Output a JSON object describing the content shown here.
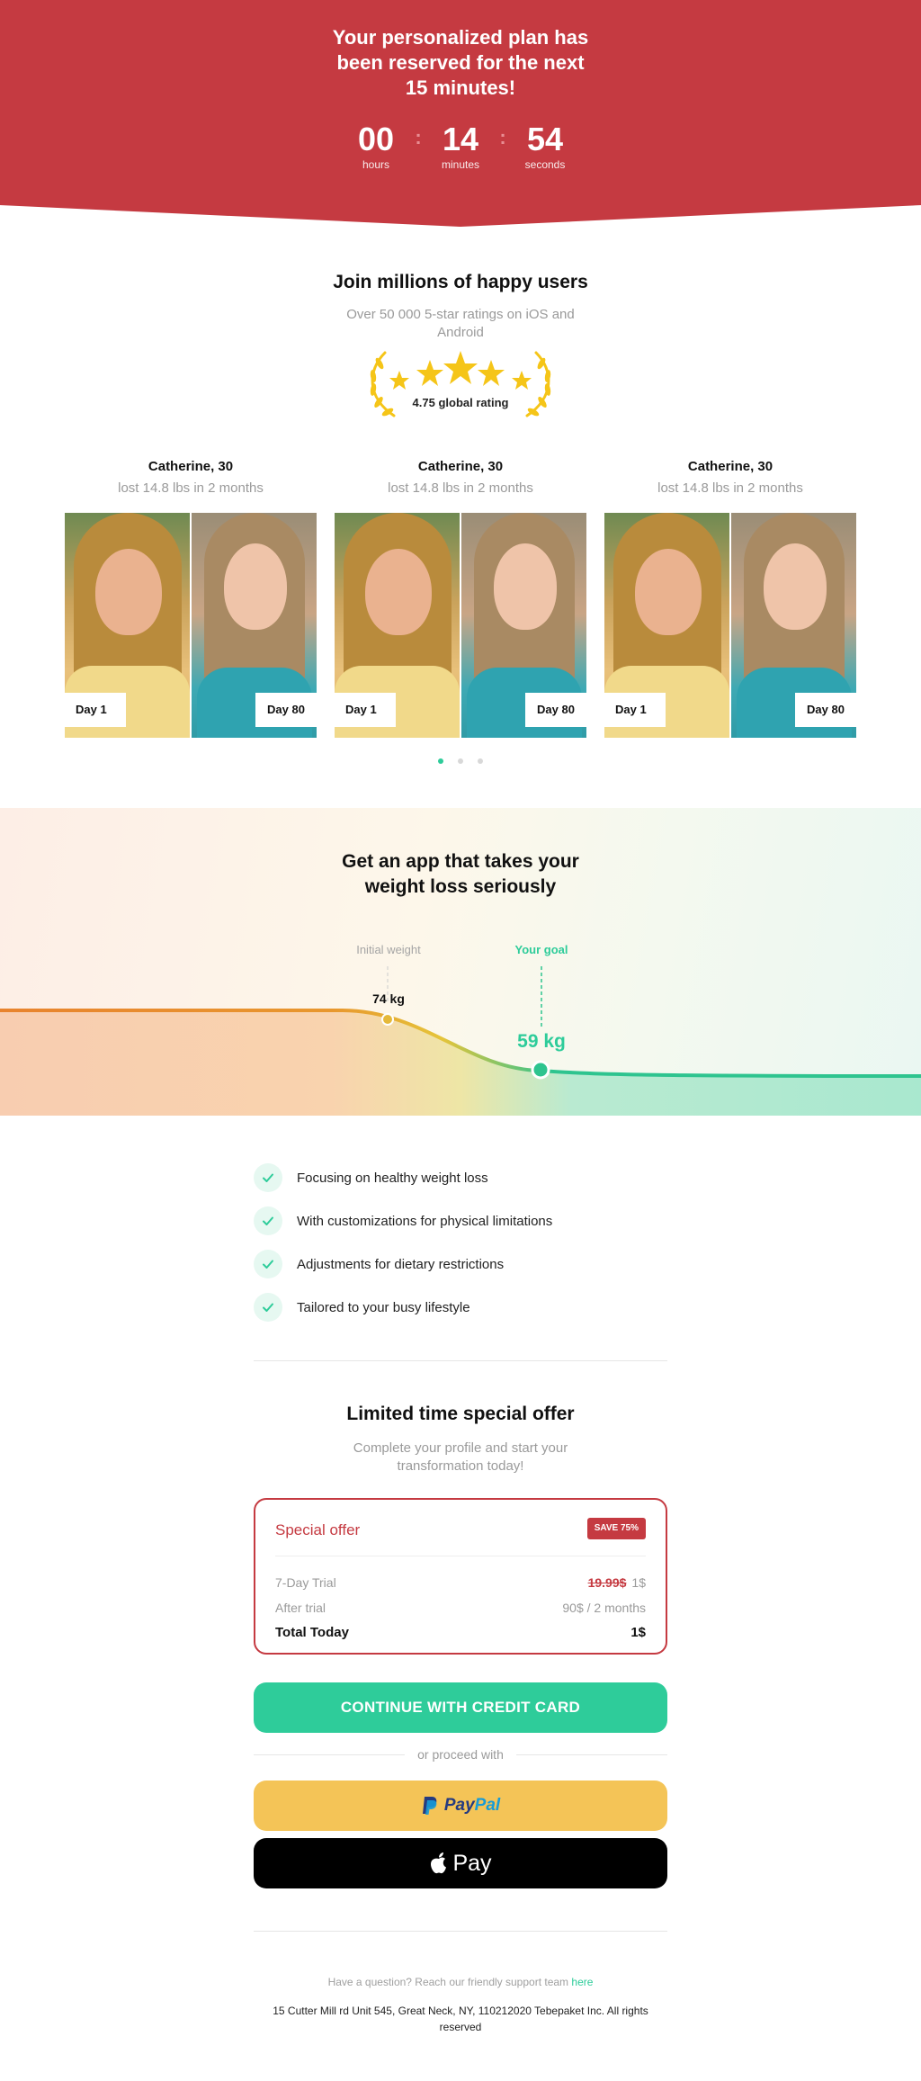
{
  "header": {
    "title": "Your personalized plan has been reserved for the next 15 minutes!",
    "timer": {
      "hours": "00",
      "hours_label": "hours",
      "minutes": "14",
      "minutes_label": "minutes",
      "seconds": "54",
      "seconds_label": "seconds",
      "separator": ":"
    },
    "background_color": "#c53a41"
  },
  "social": {
    "title": "Join millions of happy users",
    "subtitle": "Over 50 000 5-star ratings on iOS and Android",
    "rating_text": "4.75 global rating",
    "star_color": "#f5c518",
    "testimonials": [
      {
        "name": "Catherine, 30",
        "result": "lost 14.8 lbs in 2 months",
        "before_label": "Day 1",
        "after_label": "Day 80"
      },
      {
        "name": "Catherine, 30",
        "result": "lost 14.8 lbs in 2 months",
        "before_label": "Day 1",
        "after_label": "Day 80"
      },
      {
        "name": "Catherine, 30",
        "result": "lost 14.8 lbs in 2 months",
        "before_label": "Day 1",
        "after_label": "Day 80"
      }
    ],
    "carousel_active_index": 0,
    "carousel_count": 3
  },
  "weight": {
    "title": "Get an app that takes your weight loss seriously",
    "initial_label": "Initial weight",
    "initial_value": "74 kg",
    "goal_label": "Your goal",
    "goal_value": "59 kg",
    "colors": {
      "start": "#e8832e",
      "middle": "#e5c43a",
      "end": "#2ec48f"
    }
  },
  "features": [
    "Focusing on healthy weight loss",
    "With customizations for physical limitations",
    "Adjustments for dietary restrictions",
    "Tailored to your busy lifestyle"
  ],
  "offer": {
    "title": "Limited time special offer",
    "subtitle": "Complete your profile and start your transformation today!",
    "card_title": "Special offer",
    "badge": "SAVE 75%",
    "rows": {
      "trial_label": "7-Day Trial",
      "trial_old_price": "19.99$",
      "trial_price": "1$",
      "after_label": "After trial",
      "after_value": "90$ / 2 months",
      "total_label": "Total Today",
      "total_value": "1$"
    },
    "accent_color": "#c53a41"
  },
  "actions": {
    "credit_card": "CONTINUE WITH CREDIT CARD",
    "or_text": "or proceed with",
    "paypal_a": "Pay",
    "paypal_b": "Pal",
    "apple_pay": "Pay",
    "primary_color": "#2ecc9a"
  },
  "footer": {
    "question": "Have a question? Reach our friendly support team",
    "link": "here",
    "address": "15 Cutter Mill rd Unit 545, Great Neck, NY, 110212020 Tebepaket Inc. All rights reserved"
  }
}
